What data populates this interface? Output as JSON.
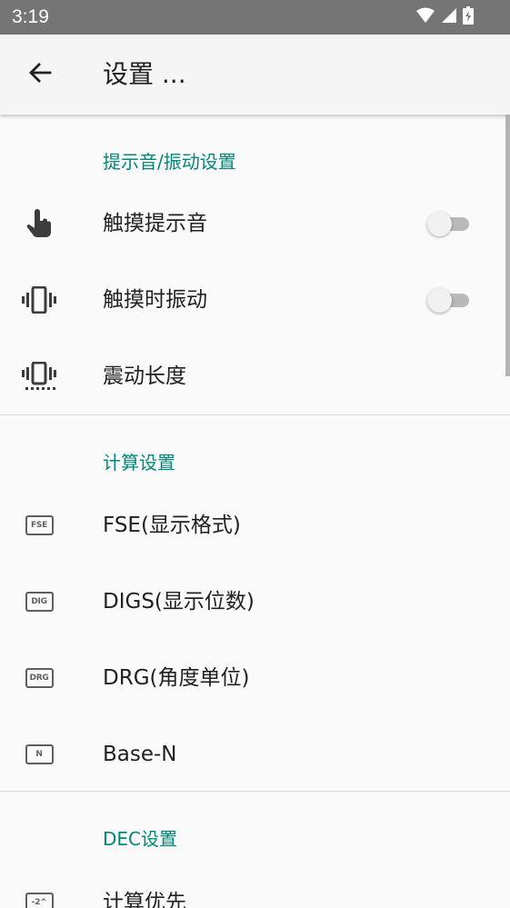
{
  "status_bar": {
    "time": "3:19",
    "icons": [
      "wifi-icon",
      "cell-signal-icon",
      "battery-charging-icon"
    ],
    "color": "#757575"
  },
  "app_bar": {
    "title": "设置 ...",
    "back_icon": "arrow-back-icon"
  },
  "accent_color": "#00897b",
  "sections": {
    "sound": {
      "title": "提示音/振动设置",
      "items": [
        {
          "label": "触摸提示音",
          "icon": "touch-icon",
          "switch_on": false
        },
        {
          "label": "触摸时振动",
          "icon": "vibration-icon",
          "switch_on": false
        },
        {
          "label": "震动长度",
          "icon": "vibration-length-icon"
        }
      ]
    },
    "calc": {
      "title": "计算设置",
      "items": [
        {
          "label": "FSE(显示格式)",
          "icon_text": "FSE"
        },
        {
          "label": "DIGS(显示位数)",
          "icon_text": "DIG"
        },
        {
          "label": "DRG(角度单位)",
          "icon_text": "DRG"
        },
        {
          "label": "Base-N",
          "icon_text": "N"
        }
      ]
    },
    "dec": {
      "title": "DEC设置",
      "items": [
        {
          "label": "计算优先",
          "icon_text": "-2^"
        }
      ]
    }
  }
}
